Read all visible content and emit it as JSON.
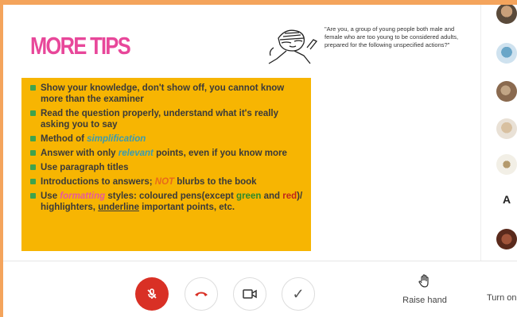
{
  "slide": {
    "title": "MORE TIPS",
    "quote": "\"Are you, a group of young people both male and female who are too young to be considered adults, prepared for the following unspecified actions?\"",
    "tips": [
      {
        "text": "Show your knowledge, don't show off, you cannot know more than the examiner"
      },
      {
        "text": "Read the question properly, understand what it's really asking you to say"
      },
      {
        "prefix": "Method of ",
        "highlight": "simplification"
      },
      {
        "prefix": "Answer with only ",
        "highlight": "relevant",
        "suffix": " points, even if you know more"
      },
      {
        "text": "Use paragraph titles"
      },
      {
        "prefix": "Introductions to answers; ",
        "highlight": "NOT",
        "suffix": " blurbs to the book"
      },
      {
        "p1": "Use ",
        "formatting": "formatting",
        "p2": " styles: coloured pens(except ",
        "green": "green",
        "p3": " and ",
        "red": "red",
        "p4": ")/ highlighters, ",
        "underline": "underline",
        "p5": " important points, etc."
      }
    ]
  },
  "participants": {
    "letter": "A"
  },
  "controls": {
    "raise_hand": "Raise hand",
    "turn_on": "Turn on"
  },
  "colors": {
    "accent_pink": "#e8479a",
    "tips_bg": "#f7b502",
    "mic_off": "#d93025",
    "end_call": "#d93025"
  }
}
